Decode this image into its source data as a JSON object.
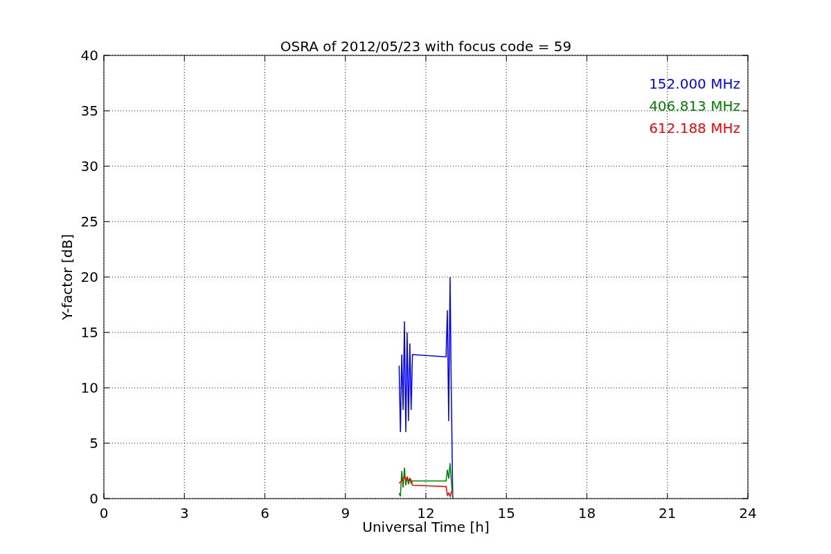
{
  "chart_data": {
    "type": "line",
    "title": "OSRA of 2012/05/23 with focus code = 59",
    "xlabel": "Universal Time [h]",
    "ylabel": "Y-factor [dB]",
    "x": [
      11.0,
      11.05,
      11.1,
      11.15,
      11.2,
      11.25,
      11.3,
      11.35,
      11.4,
      11.45,
      11.5,
      12.75,
      12.8,
      12.85,
      12.9,
      12.95,
      13.0
    ],
    "series": [
      {
        "name": "152.000 MHz",
        "color": "#0000ff",
        "values": [
          12,
          6,
          13,
          8,
          16,
          6,
          15,
          7,
          14,
          8,
          13,
          12.8,
          17,
          7,
          20,
          9,
          0
        ]
      },
      {
        "name": "406.813 MHz",
        "color": "#008000",
        "values": [
          0.5,
          0.2,
          2.5,
          1,
          2.8,
          1.2,
          2,
          1.3,
          1.8,
          1.4,
          1.6,
          1.6,
          2.6,
          1.8,
          3.2,
          1.5,
          0
        ]
      },
      {
        "name": "612.188 MHz",
        "color": "#ff0000",
        "values": [
          1.4,
          1.5,
          1.6,
          1.8,
          2,
          1.7,
          1.9,
          1.6,
          1.8,
          1.7,
          1.2,
          1.1,
          0.3,
          0.5,
          0.2,
          0.6,
          0.8
        ]
      }
    ],
    "grid": true,
    "xlim": [
      0,
      24
    ],
    "ylim": [
      0,
      40
    ],
    "xticks": [
      0,
      3,
      6,
      9,
      12,
      15,
      18,
      21,
      24
    ],
    "yticks": [
      0,
      5,
      10,
      15,
      20,
      25,
      30,
      35,
      40
    ]
  }
}
